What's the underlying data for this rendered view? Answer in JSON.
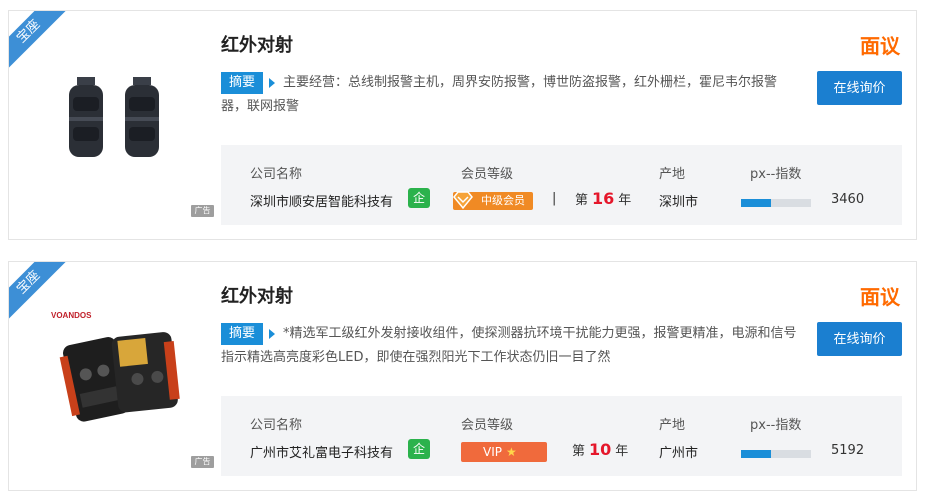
{
  "listings": [
    {
      "ribbon": "宝座",
      "title": "红外对射",
      "price": "面议",
      "tag": "摘要",
      "description": "主要经营：总线制报警主机，周界安防报警，博世防盗报警，红外栅栏，霍尼韦尔报警器，联网报警",
      "inquire_label": "在线询价",
      "ad_label": "广告",
      "labels": {
        "company": "公司名称",
        "member": "会员等级",
        "origin": "产地",
        "index": "px--指数"
      },
      "company": "深圳市顺安居智能科技有",
      "qi_badge": "企",
      "member_level": "中级会员",
      "sep": "|",
      "year_prefix": "第",
      "years": "16",
      "year_suffix": "年",
      "origin": "深圳市",
      "index_value": "3460",
      "index_fill": 0.43
    },
    {
      "ribbon": "宝座",
      "title": "红外对射",
      "price": "面议",
      "tag": "摘要",
      "description": "*精选军工级红外发射接收组件，使探测器抗环境干扰能力更强，报警更精准，电源和信号指示精选高亮度彩色LED，即使在强烈阳光下工作状态仍旧一目了然",
      "inquire_label": "在线询价",
      "ad_label": "广告",
      "labels": {
        "company": "公司名称",
        "member": "会员等级",
        "origin": "产地",
        "index": "px--指数"
      },
      "company": "广州市艾礼富电子科技有",
      "qi_badge": "企",
      "member_level": "VIP",
      "year_prefix": "第",
      "years": "10",
      "year_suffix": "年",
      "origin": "广州市",
      "index_value": "5192",
      "index_fill": 0.43,
      "brand_text": "VOANDOS"
    }
  ],
  "colors": {
    "accent": "#1b7fd0",
    "price": "#ff6a00",
    "ribbon": "#3d8fd6",
    "years": "#e5172b"
  },
  "icons": [
    "diamond-icon",
    "star-icon",
    "arrow-right-icon"
  ]
}
